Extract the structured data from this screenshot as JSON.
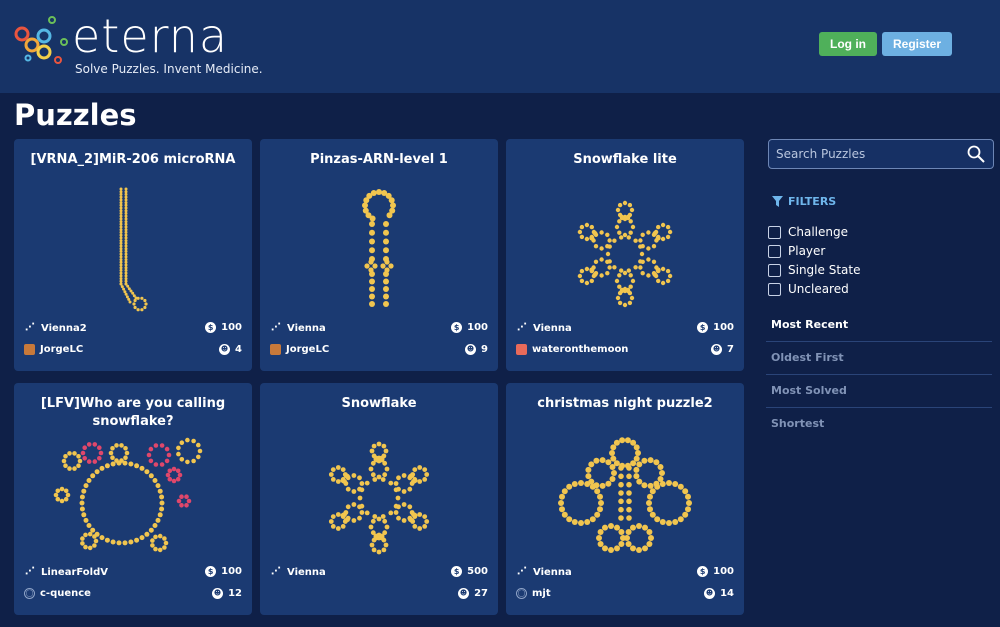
{
  "header": {
    "brand": "eterna",
    "tagline": "Solve Puzzles. Invent Medicine.",
    "login_label": "Log in",
    "register_label": "Register"
  },
  "page_title": "Puzzles",
  "search": {
    "placeholder": "Search Puzzles"
  },
  "filters": {
    "title": "FILTERS",
    "options": [
      "Challenge",
      "Player",
      "Single State",
      "Uncleared"
    ]
  },
  "sort": {
    "options": [
      "Most Recent",
      "Oldest First",
      "Most Solved",
      "Shortest"
    ],
    "active": "Most Recent"
  },
  "puzzles": [
    {
      "title": "[VRNA_2]MiR-206 microRNA",
      "engine": "Vienna2",
      "reward": "100",
      "author": "JorgeLC",
      "solvers": "4"
    },
    {
      "title": "Pinzas-ARN-level 1",
      "engine": "Vienna",
      "reward": "100",
      "author": "JorgeLC",
      "solvers": "9"
    },
    {
      "title": "Snowflake lite",
      "engine": "Vienna",
      "reward": "100",
      "author": "wateronthemoon",
      "solvers": "7"
    },
    {
      "title": "[LFV]Who are you calling snowflake?",
      "engine": "LinearFoldV",
      "reward": "100",
      "author": "c-quence",
      "solvers": "12"
    },
    {
      "title": "Snowflake",
      "engine": "Vienna",
      "reward": "500",
      "author": "",
      "solvers": "27"
    },
    {
      "title": "christmas night puzzle2",
      "engine": "Vienna",
      "reward": "100",
      "author": "mjt",
      "solvers": "14"
    }
  ],
  "colors": {
    "header_bg": "#173366",
    "page_bg": "#0f2048",
    "card_bg": "#1b3a72",
    "base": "#f1c54f",
    "login": "#4fb05a",
    "register": "#6db0e2"
  },
  "icons": [
    "engine-icon",
    "coin-icon",
    "author-avatar",
    "players-icon",
    "search-icon",
    "filter-icon"
  ]
}
